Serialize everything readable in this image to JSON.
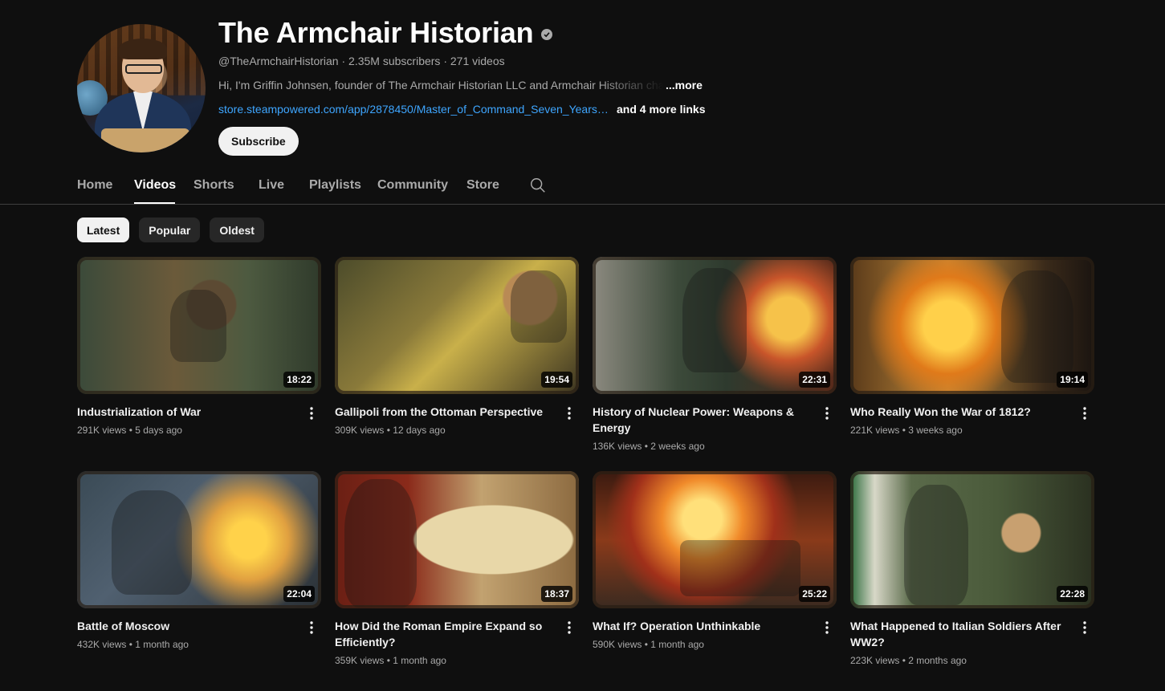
{
  "channel": {
    "name": "The Armchair Historian",
    "handle": "@TheArmchairHistorian",
    "subscribers": "2.35M subscribers",
    "video_count": "271 videos",
    "meta_separator": " · ",
    "description": "Hi, I'm Griffin Johnsen, founder of The Armchair Historian LLC and Armchair Historian cha",
    "more_label": "...more",
    "link_url": "store.steampowered.com/app/2878450/Master_of_Command_Seven_Years_...",
    "more_links_label": "and 4 more links",
    "subscribe_label": "Subscribe"
  },
  "tabs": [
    {
      "label": "Home",
      "active": false
    },
    {
      "label": "Videos",
      "active": true
    },
    {
      "label": "Shorts",
      "active": false
    },
    {
      "label": "Live",
      "active": false
    },
    {
      "label": "Playlists",
      "active": false
    },
    {
      "label": "Community",
      "active": false
    },
    {
      "label": "Store",
      "active": false
    }
  ],
  "chips": [
    {
      "label": "Latest",
      "selected": true
    },
    {
      "label": "Popular",
      "selected": false
    },
    {
      "label": "Oldest",
      "selected": false
    }
  ],
  "videos": [
    {
      "title": "Industrialization of War",
      "views": "291K views",
      "age": "5 days ago",
      "duration": "18:22"
    },
    {
      "title": "Gallipoli from the Ottoman Perspective",
      "views": "309K views",
      "age": "12 days ago",
      "duration": "19:54"
    },
    {
      "title": "History of Nuclear Power: Weapons & Energy",
      "views": "136K views",
      "age": "2 weeks ago",
      "duration": "22:31"
    },
    {
      "title": "Who Really Won the War of 1812?",
      "views": "221K views",
      "age": "3 weeks ago",
      "duration": "19:14"
    },
    {
      "title": "Battle of Moscow",
      "views": "432K views",
      "age": "1 month ago",
      "duration": "22:04"
    },
    {
      "title": "How Did the Roman Empire Expand so Efficiently?",
      "views": "359K views",
      "age": "1 month ago",
      "duration": "18:37"
    },
    {
      "title": "What If? Operation Unthinkable",
      "views": "590K views",
      "age": "1 month ago",
      "duration": "25:22"
    },
    {
      "title": "What Happened to Italian Soldiers After WW2?",
      "views": "223K views",
      "age": "2 months ago",
      "duration": "22:28"
    }
  ],
  "meta_dot": " • ",
  "icons": {
    "verified": "verified-check-icon",
    "search": "search-icon",
    "menu": "more-vert-icon"
  },
  "colors": {
    "background": "#0f0f0f",
    "link": "#3ea6ff",
    "text_primary": "#f1f1f1",
    "text_secondary": "#aaaaaa"
  }
}
